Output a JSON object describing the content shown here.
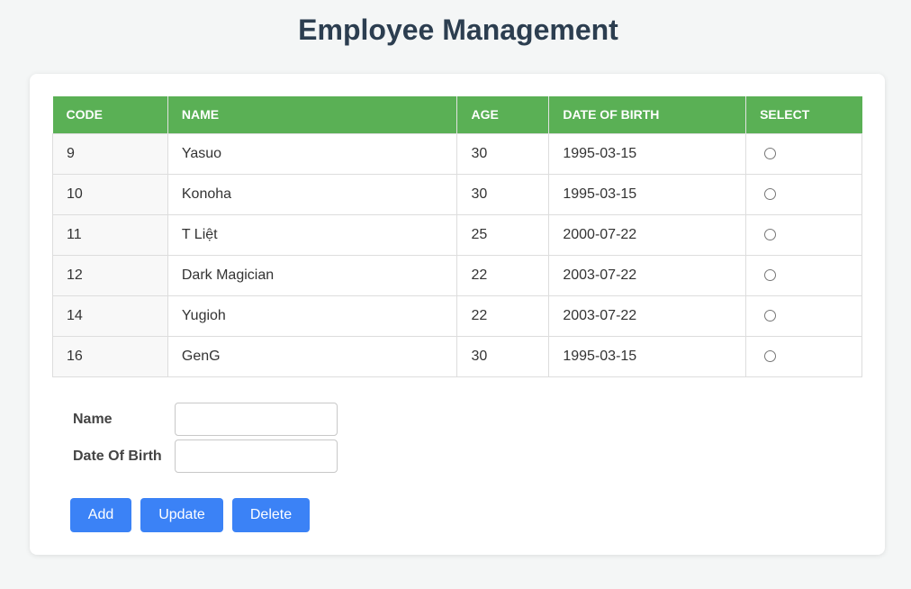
{
  "page": {
    "title": "Employee Management"
  },
  "table": {
    "columns": [
      "CODE",
      "NAME",
      "AGE",
      "DATE OF BIRTH",
      "SELECT"
    ],
    "rows": [
      {
        "code": "9",
        "name": "Yasuo",
        "age": "30",
        "dob": "1995-03-15",
        "selected": false
      },
      {
        "code": "10",
        "name": "Konoha",
        "age": "30",
        "dob": "1995-03-15",
        "selected": false
      },
      {
        "code": "11",
        "name": "T Liệt",
        "age": "25",
        "dob": "2000-07-22",
        "selected": false
      },
      {
        "code": "12",
        "name": "Dark Magician",
        "age": "22",
        "dob": "2003-07-22",
        "selected": false
      },
      {
        "code": "14",
        "name": "Yugioh",
        "age": "22",
        "dob": "2003-07-22",
        "selected": false
      },
      {
        "code": "16",
        "name": "GenG",
        "age": "30",
        "dob": "1995-03-15",
        "selected": false
      }
    ]
  },
  "form": {
    "name_label": "Name",
    "name_value": "",
    "dob_label": "Date Of Birth",
    "dob_value": ""
  },
  "buttons": {
    "add": "Add",
    "update": "Update",
    "delete": "Delete"
  },
  "colors": {
    "header_green": "#5ab055",
    "button_blue": "#3b82f6",
    "title_text": "#2c3e50"
  }
}
